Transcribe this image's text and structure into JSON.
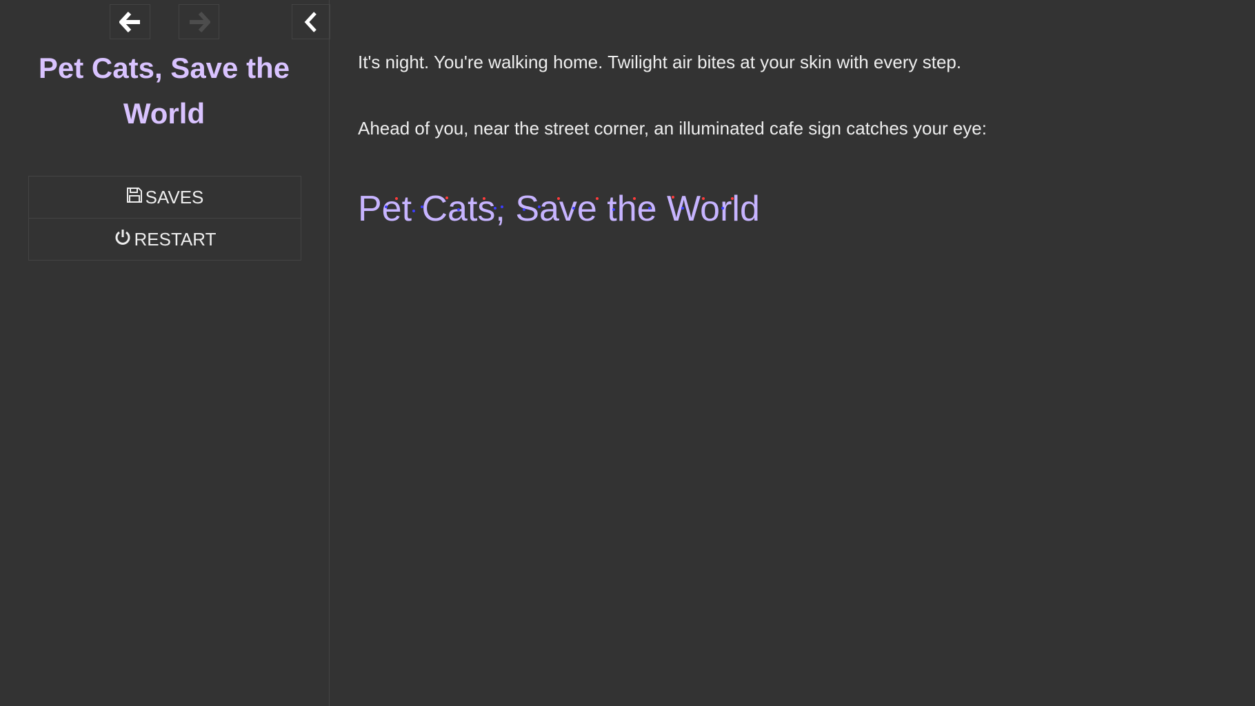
{
  "sidebar": {
    "nav": {
      "back_icon": "arrow-left-icon",
      "forward_icon": "arrow-right-icon",
      "toggle_icon": "chevron-left-icon"
    },
    "story_title": "Pet Cats, Save the World",
    "menu": {
      "saves_label": "SAVES",
      "saves_icon": "floppy-disk-icon",
      "restart_label": "RESTART",
      "restart_icon": "power-icon"
    }
  },
  "passage": {
    "paragraphs": [
      "It's night. You're walking home. Twilight air bites at your skin with every step.",
      "Ahead of you, near the street corner, an illuminated cafe sign catches your eye:"
    ],
    "sign_text": "Pet Cats, Save the World"
  },
  "colors": {
    "background": "#333333",
    "title": "#d9c3ff",
    "sign_text": "#c7b4ff",
    "sparkle_red": "#ff3b3b",
    "sparkle_blue": "#3d3dff",
    "body_text": "#eeeeee"
  }
}
